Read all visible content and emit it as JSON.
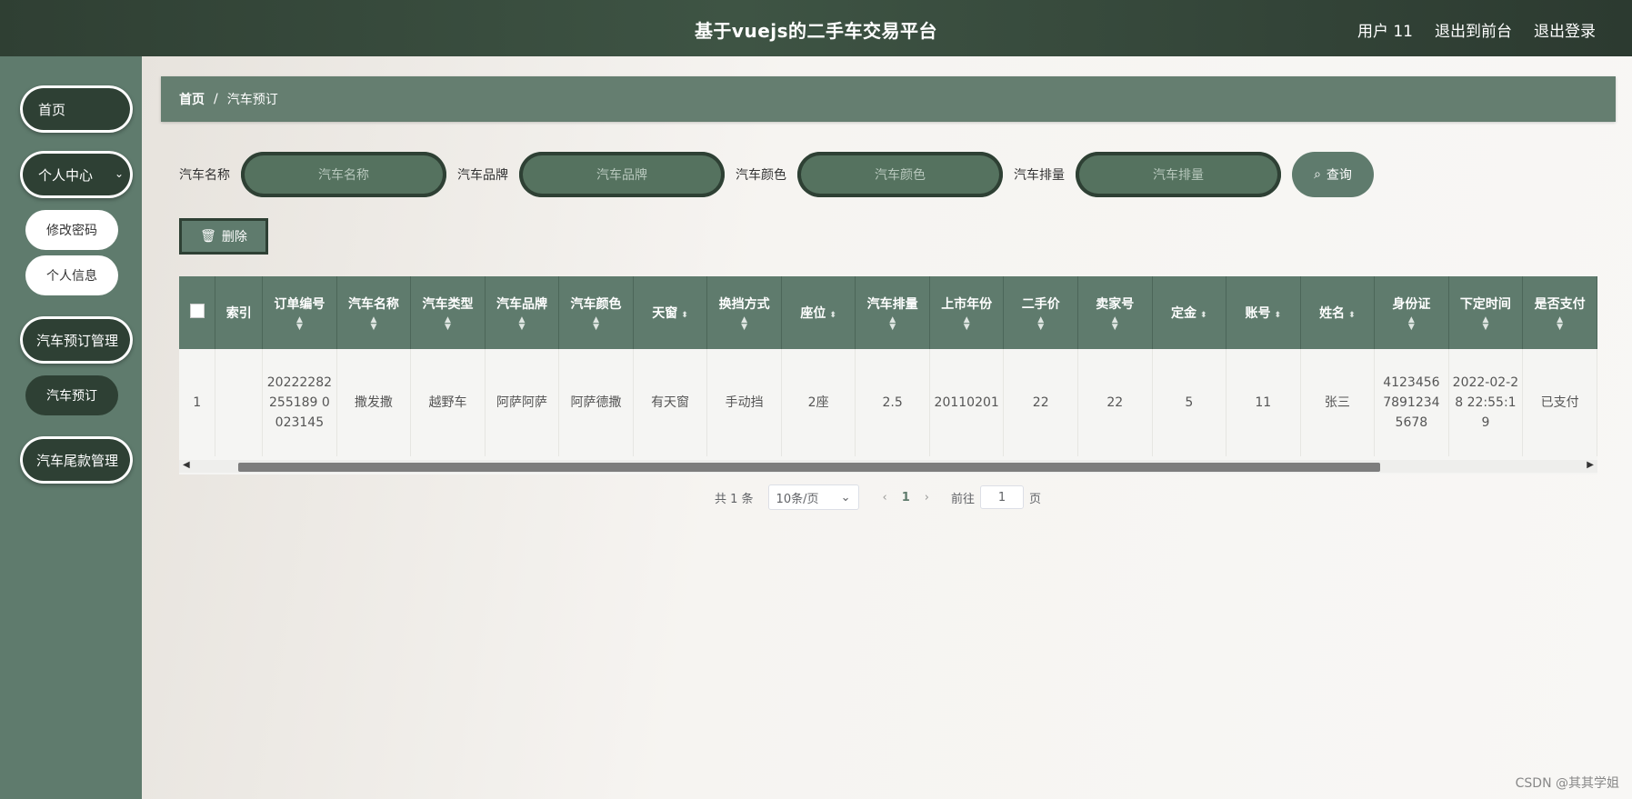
{
  "header": {
    "title": "基于vuejs的二手车交易平台",
    "user": "用户 11",
    "front": "退出到前台",
    "logout": "退出登录"
  },
  "sidebar": {
    "home": "首页",
    "personal": "个人中心",
    "change_pwd": "修改密码",
    "profile": "个人信息",
    "booking_mgmt": "汽车预订管理",
    "booking": "汽车预订",
    "balance_mgmt": "汽车尾款管理"
  },
  "breadcrumb": {
    "home": "首页",
    "sep": "/",
    "current": "汽车预订"
  },
  "search": {
    "fields": [
      {
        "label": "汽车名称",
        "placeholder": "汽车名称"
      },
      {
        "label": "汽车品牌",
        "placeholder": "汽车品牌"
      },
      {
        "label": "汽车颜色",
        "placeholder": "汽车颜色"
      },
      {
        "label": "汽车排量",
        "placeholder": "汽车排量"
      }
    ],
    "query_label": "查询"
  },
  "actions": {
    "delete_label": "删除"
  },
  "table": {
    "columns": [
      "索引",
      "订单编号",
      "汽车名称",
      "汽车类型",
      "汽车品牌",
      "汽车颜色",
      "天窗",
      "换挡方式",
      "座位",
      "汽车排量",
      "上市年份",
      "二手价",
      "卖家号",
      "定金",
      "账号",
      "姓名",
      "身份证",
      "下定时间",
      "是否支付"
    ],
    "rows": [
      [
        "1",
        "20222282255189 0023145",
        "撒发撒",
        "越野车",
        "阿萨阿萨",
        "阿萨德撒",
        "有天窗",
        "手动挡",
        "2座",
        "2.5",
        "20110201",
        "22",
        "22",
        "5",
        "11",
        "张三",
        "4123456 7891234 5678",
        "2022-02-28 22:55:19",
        "已支付"
      ]
    ]
  },
  "pagination": {
    "total": "共 1 条",
    "page_size": "10条/页",
    "current": "1",
    "goto_label": "前往",
    "goto_value": "1",
    "page_unit": "页"
  },
  "watermark": "CSDN @其其学姐"
}
